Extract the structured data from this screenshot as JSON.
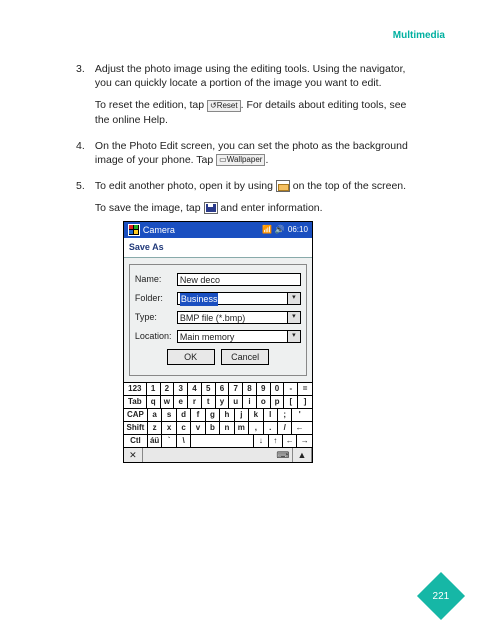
{
  "header": {
    "section": "Multimedia"
  },
  "steps": [
    {
      "num": "3.",
      "text": "Adjust the photo image using the editing tools. Using the navigator, you can quickly locate a portion of the image you want to edit.",
      "sub": {
        "pre": "To reset the edition, tap ",
        "btn": "Reset",
        "post": ". For details about editing tools, see the online Help."
      }
    },
    {
      "num": "4.",
      "text": "On the Photo Edit screen, you can set the photo as the background image of your phone. Tap ",
      "btn": "Wallpaper",
      "post": "."
    },
    {
      "num": "5.",
      "text_pre": "To edit another photo, open it by using ",
      "text_post": " on the top of the screen.",
      "sub_pre": "To save the image, tap ",
      "sub_post": " and enter information."
    }
  ],
  "fig": {
    "title": "Camera",
    "clock": "06:10",
    "saveas": "Save As",
    "labels": {
      "name": "Name:",
      "folder": "Folder:",
      "type": "Type:",
      "location": "Location:"
    },
    "values": {
      "name": "New deco",
      "folder": "Business",
      "type": "BMP file (*.bmp)",
      "location": "Main memory"
    },
    "buttons": {
      "ok": "OK",
      "cancel": "Cancel"
    },
    "keyboard": {
      "r1": [
        "123",
        "1",
        "2",
        "3",
        "4",
        "5",
        "6",
        "7",
        "8",
        "9",
        "0",
        "-",
        "="
      ],
      "r2": [
        "Tab",
        "q",
        "w",
        "e",
        "r",
        "t",
        "y",
        "u",
        "i",
        "o",
        "p",
        "[",
        "]"
      ],
      "r3": [
        "CAP",
        "a",
        "s",
        "d",
        "f",
        "g",
        "h",
        "j",
        "k",
        "l",
        ";",
        "'"
      ],
      "r4": [
        "Shift",
        "z",
        "x",
        "c",
        "v",
        "b",
        "n",
        "m",
        ",",
        ".",
        "/",
        "←"
      ],
      "r5": [
        "Ctl",
        "áü",
        "`",
        "\\",
        " ",
        "↓",
        "↑",
        "←",
        "→"
      ]
    }
  },
  "page": "221"
}
